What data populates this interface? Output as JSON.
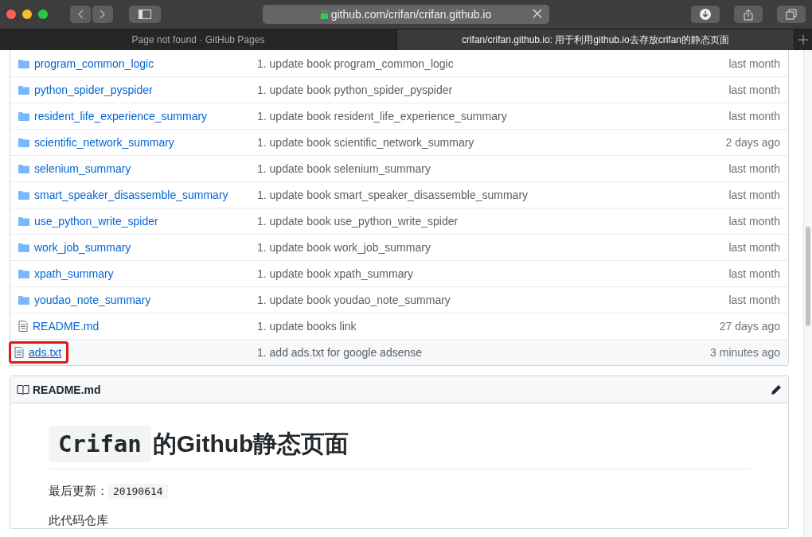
{
  "browser": {
    "address": "github.com/crifan/crifan.github.io",
    "tabs": [
      {
        "title": "Page not found · GitHub Pages",
        "selected": false
      },
      {
        "title": "crifan/crifan.github.io: 用于利用github.io去存放crifan的静态页面",
        "selected": true
      }
    ]
  },
  "files": [
    {
      "kind": "folder",
      "name": "program_common_logic",
      "message": "1. update book program_common_logic",
      "age": "last month",
      "annotated": false
    },
    {
      "kind": "folder",
      "name": "python_spider_pyspider",
      "message": "1. update book python_spider_pyspider",
      "age": "last month",
      "annotated": false
    },
    {
      "kind": "folder",
      "name": "resident_life_experience_summary",
      "message": "1. update book resident_life_experience_summary",
      "age": "last month",
      "annotated": false
    },
    {
      "kind": "folder",
      "name": "scientific_network_summary",
      "message": "1. update book scientific_network_summary",
      "age": "2 days ago",
      "annotated": false
    },
    {
      "kind": "folder",
      "name": "selenium_summary",
      "message": "1. update book selenium_summary",
      "age": "last month",
      "annotated": false
    },
    {
      "kind": "folder",
      "name": "smart_speaker_disassemble_summary",
      "message": "1. update book smart_speaker_disassemble_summary",
      "age": "last month",
      "annotated": false
    },
    {
      "kind": "folder",
      "name": "use_python_write_spider",
      "message": "1. update book use_python_write_spider",
      "age": "last month",
      "annotated": false
    },
    {
      "kind": "folder",
      "name": "work_job_summary",
      "message": "1. update book work_job_summary",
      "age": "last month",
      "annotated": false
    },
    {
      "kind": "folder",
      "name": "xpath_summary",
      "message": "1. update book xpath_summary",
      "age": "last month",
      "annotated": false
    },
    {
      "kind": "folder",
      "name": "youdao_note_summary",
      "message": "1. update book youdao_note_summary",
      "age": "last month",
      "annotated": false
    },
    {
      "kind": "file",
      "name": "README.md",
      "message": "1. update books link",
      "age": "27 days ago",
      "annotated": false
    },
    {
      "kind": "file",
      "name": "ads.txt",
      "message": "1. add ads.txt for google adsense",
      "age": "3 minutes ago",
      "annotated": true
    }
  ],
  "readme": {
    "title": "README.md",
    "heading_code": "Crifan",
    "heading_text": "的Github静态页面",
    "updated_label": "最后更新：",
    "updated_value": "20190614",
    "paragraph": "此代码仓库"
  }
}
